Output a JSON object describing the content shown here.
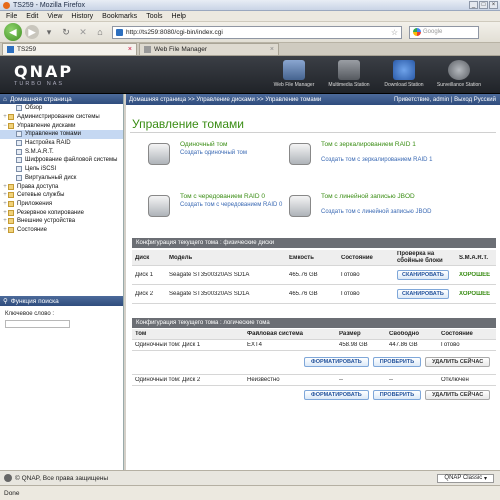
{
  "window": {
    "title": "TS259 - Mozilla Firefox"
  },
  "menu": [
    "File",
    "Edit",
    "View",
    "History",
    "Bookmarks",
    "Tools",
    "Help"
  ],
  "nav": {
    "url": "http://ts259:8080/cgi-bin/index.cgi",
    "search_placeholder": "Google"
  },
  "tabs": [
    {
      "label": "TS259"
    },
    {
      "label": "Web File Manager"
    }
  ],
  "header": {
    "logo": "QNAP",
    "subtitle": "TURBO NAS",
    "icons": [
      {
        "label": "Web File Manager",
        "color": "#5577aa"
      },
      {
        "label": "Multimedia Station",
        "color": "#777b80"
      },
      {
        "label": "Download Station",
        "color": "#3a6fc1"
      },
      {
        "label": "Surveillance Station",
        "color": "#888c92"
      }
    ]
  },
  "sidebar": {
    "header": "Домашняя страница",
    "items": [
      {
        "label": "Обзор",
        "depth": 1,
        "exp": ""
      },
      {
        "label": "Администрирование системы",
        "depth": 0,
        "exp": "+",
        "folder": true
      },
      {
        "label": "Управление дисками",
        "depth": 0,
        "exp": "−",
        "folder": true
      },
      {
        "label": "Управление томами",
        "depth": 1,
        "exp": "",
        "selected": true
      },
      {
        "label": "Настройка RAID",
        "depth": 1,
        "exp": ""
      },
      {
        "label": "S.M.A.R.T.",
        "depth": 1,
        "exp": ""
      },
      {
        "label": "Шифрование файловой системы",
        "depth": 1,
        "exp": ""
      },
      {
        "label": "Цель iSCSI",
        "depth": 1,
        "exp": ""
      },
      {
        "label": "Виртуальный диск",
        "depth": 1,
        "exp": ""
      },
      {
        "label": "Права доступа",
        "depth": 0,
        "exp": "+",
        "folder": true
      },
      {
        "label": "Сетевые службы",
        "depth": 0,
        "exp": "+",
        "folder": true
      },
      {
        "label": "Приложения",
        "depth": 0,
        "exp": "+",
        "folder": true
      },
      {
        "label": "Резервное копирование",
        "depth": 0,
        "exp": "+",
        "folder": true
      },
      {
        "label": "Внешние устройства",
        "depth": 0,
        "exp": "+",
        "folder": true
      },
      {
        "label": "Состояние",
        "depth": 0,
        "exp": "+",
        "folder": true
      }
    ],
    "search_header": "Функция поиска",
    "keyword_label": "Ключевое слово :"
  },
  "crumb": {
    "path": "Домашняя страница >> Управление дисками >> Управление томами",
    "right": "Приветствие, admin | Выход   Русский"
  },
  "page": {
    "title": "Управление томами",
    "options": [
      {
        "title": "Одиночный том",
        "link": "Создать одиночный том"
      },
      {
        "title": "Том с зеркалированием RAID 1",
        "link": "Создать том с зеркалированием RAID 1"
      },
      {
        "title": "Том с чередованием RAID 0",
        "link": "Создать том с чередованием RAID 0"
      },
      {
        "title": "Том с линейной записью JBOD",
        "link": "Создать том с линейной записью JBOD"
      }
    ]
  },
  "physical": {
    "header": "Конфигурация текущего тома : физические диски",
    "columns": [
      "Диск",
      "Модель",
      "Емкость",
      "Состояние",
      "Проверка на сбойные блоки",
      "S.M.A.R.T."
    ],
    "rows": [
      {
        "disk": "Диск 1",
        "model": "Seagate ST3500320AS SD1A",
        "capacity": "465.76 GB",
        "status": "Готово",
        "scan": "СКАНИРОВАТЬ",
        "smart": "ХОРОШЕЕ"
      },
      {
        "disk": "Диск 2",
        "model": "Seagate ST3500320AS SD1A",
        "capacity": "465.76 GB",
        "status": "Готово",
        "scan": "СКАНИРОВАТЬ",
        "smart": "ХОРОШЕЕ"
      }
    ]
  },
  "logical": {
    "header": "Конфигурация текущего тома : логические тома",
    "columns": [
      "Том",
      "Файловая система",
      "Размер",
      "Свободно",
      "Состояние"
    ],
    "rows": [
      {
        "volume": "Одиночный том: Диск 1",
        "fs": "EXT4",
        "size": "458.98 GB",
        "free": "447.86 GB",
        "status": "Готово"
      },
      {
        "volume": "Одиночный том: Диск 2",
        "fs": "Неизвестно",
        "size": "--",
        "free": "--",
        "status": "Отключен"
      }
    ],
    "actions": {
      "format": "ФОРМАТИРОВАТЬ",
      "check": "ПРОВЕРИТЬ",
      "delete": "УДАЛИТЬ СЕЙЧАС"
    }
  },
  "footer": {
    "copyright": "© QNAP, Все права защищены",
    "theme": "QNAP Classic"
  },
  "status": "Done"
}
